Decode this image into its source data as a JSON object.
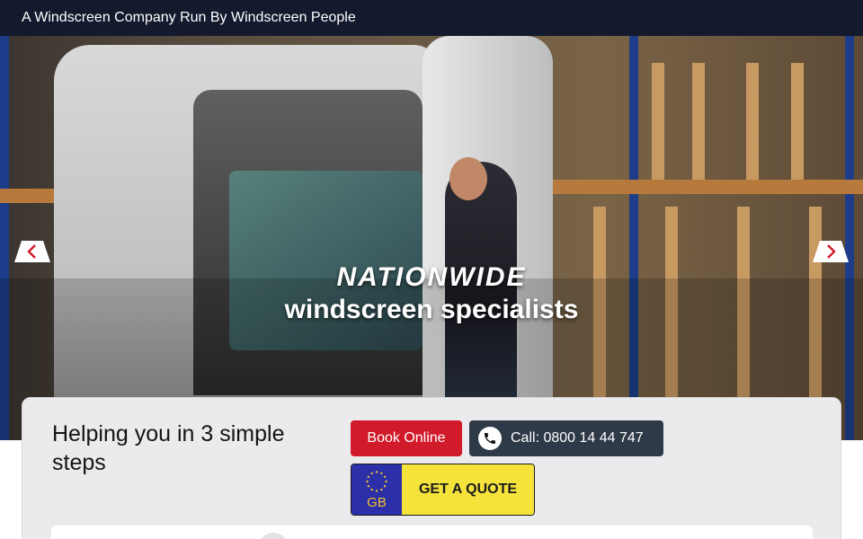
{
  "topbar": {
    "tagline": "A Windscreen Company Run By Windscreen People"
  },
  "hero": {
    "title": "NATIONWIDE",
    "subtitle": "windscreen specialists",
    "prev_icon": "chevron-left-icon",
    "next_icon": "chevron-right-icon"
  },
  "panel": {
    "heading": "Helping you in 3 simple steps",
    "book_label": "Book Online",
    "call_label": "Call: 0800 14 44 747",
    "plate_country": "GB",
    "quote_label": "GET A QUOTE"
  },
  "colors": {
    "topbar_bg": "#141a2e",
    "book_bg": "#d11a2a",
    "call_bg": "#2f3a48",
    "plate_bg": "#2b2fa8",
    "quote_bg": "#f5e33c"
  }
}
